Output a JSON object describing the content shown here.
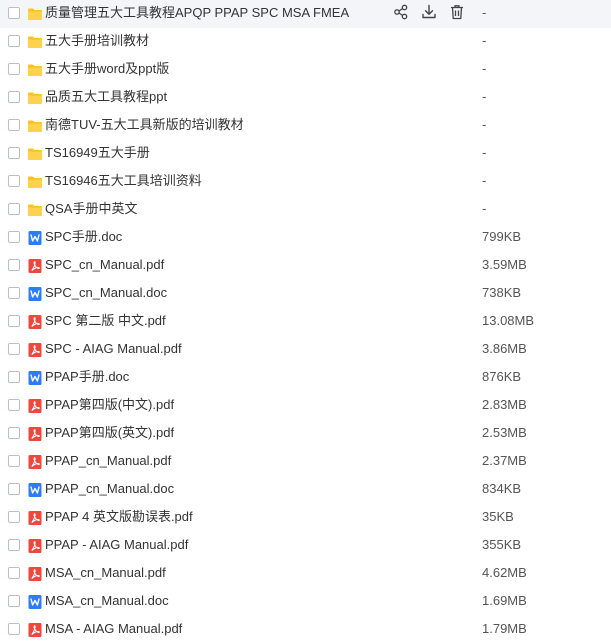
{
  "files": [
    {
      "name": "质量管理五大工具教程APQP PPAP SPC MSA FMEA",
      "size": "-",
      "type": "folder"
    },
    {
      "name": "五大手册培训教材",
      "size": "-",
      "type": "folder"
    },
    {
      "name": "五大手册word及ppt版",
      "size": "-",
      "type": "folder"
    },
    {
      "name": "品质五大工具教程ppt",
      "size": "-",
      "type": "folder"
    },
    {
      "name": "南德TUV-五大工具新版的培训教材",
      "size": "-",
      "type": "folder"
    },
    {
      "name": "TS16949五大手册",
      "size": "-",
      "type": "folder"
    },
    {
      "name": "TS16946五大工具培训资料",
      "size": "-",
      "type": "folder"
    },
    {
      "name": "QSA手册中英文",
      "size": "-",
      "type": "folder"
    },
    {
      "name": "SPC手册.doc",
      "size": "799KB",
      "type": "word"
    },
    {
      "name": "SPC_cn_Manual.pdf",
      "size": "3.59MB",
      "type": "pdf"
    },
    {
      "name": "SPC_cn_Manual.doc",
      "size": "738KB",
      "type": "word"
    },
    {
      "name": "SPC 第二版 中文.pdf",
      "size": "13.08MB",
      "type": "pdf"
    },
    {
      "name": "SPC - AIAG Manual.pdf",
      "size": "3.86MB",
      "type": "pdf"
    },
    {
      "name": "PPAP手册.doc",
      "size": "876KB",
      "type": "word"
    },
    {
      "name": "PPAP第四版(中文).pdf",
      "size": "2.83MB",
      "type": "pdf"
    },
    {
      "name": "PPAP第四版(英文).pdf",
      "size": "2.53MB",
      "type": "pdf"
    },
    {
      "name": "PPAP_cn_Manual.pdf",
      "size": "2.37MB",
      "type": "pdf"
    },
    {
      "name": "PPAP_cn_Manual.doc",
      "size": "834KB",
      "type": "word"
    },
    {
      "name": "PPAP 4 英文版勘误表.pdf",
      "size": "35KB",
      "type": "pdf"
    },
    {
      "name": "PPAP - AIAG Manual.pdf",
      "size": "355KB",
      "type": "pdf"
    },
    {
      "name": "MSA_cn_Manual.pdf",
      "size": "4.62MB",
      "type": "pdf"
    },
    {
      "name": "MSA_cn_Manual.doc",
      "size": "1.69MB",
      "type": "word"
    },
    {
      "name": "MSA - AIAG Manual.pdf",
      "size": "1.79MB",
      "type": "pdf"
    }
  ],
  "hover_actions": [
    "share-icon",
    "download-icon",
    "delete-icon"
  ],
  "colors": {
    "folder": "#ffc21e",
    "word": "#2b7cf6",
    "pdf": "#f0463c",
    "hover_bg": "#f3f5f9"
  }
}
